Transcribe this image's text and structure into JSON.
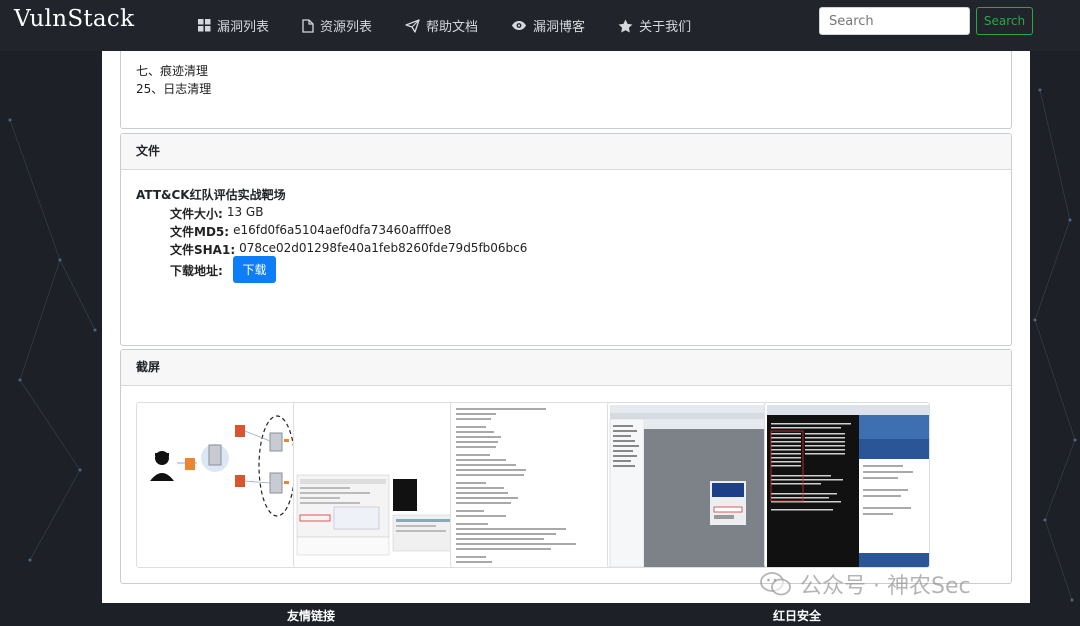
{
  "brand": "VulnStack",
  "nav": {
    "items": [
      {
        "label": "漏洞列表",
        "icon": "grid-icon"
      },
      {
        "label": "资源列表",
        "icon": "file-icon"
      },
      {
        "label": "帮助文档",
        "icon": "paper-plane-icon"
      },
      {
        "label": "漏洞博客",
        "icon": "eye-icon"
      },
      {
        "label": "关于我们",
        "icon": "star-icon"
      }
    ]
  },
  "search": {
    "placeholder": "Search",
    "button_label": "Search"
  },
  "toc": {
    "lines": [
      "七、痕迹清理",
      "25、日志清理"
    ]
  },
  "file_card": {
    "header": "文件",
    "title": "ATT&CK红队评估实战靶场",
    "size_label": "文件大小:",
    "size_value": "13 GB",
    "md5_label": "文件MD5:",
    "md5_value": "e16fd0f6a5104aef0dfa73460afff0e8",
    "sha1_label": "文件SHA1:",
    "sha1_value": "078ce02d01298fe40a1feb8260fde79d5fb06bc6",
    "download_label": "下载地址:",
    "download_button": "下载"
  },
  "screens_card": {
    "header": "截屏"
  },
  "footer": {
    "links_label": "友情链接",
    "team_label": "红日安全"
  },
  "watermark": "公众号 · 神农Sec",
  "colors": {
    "accent": "#0d7ef8",
    "success": "#28a745",
    "navbar": "#21252b"
  }
}
